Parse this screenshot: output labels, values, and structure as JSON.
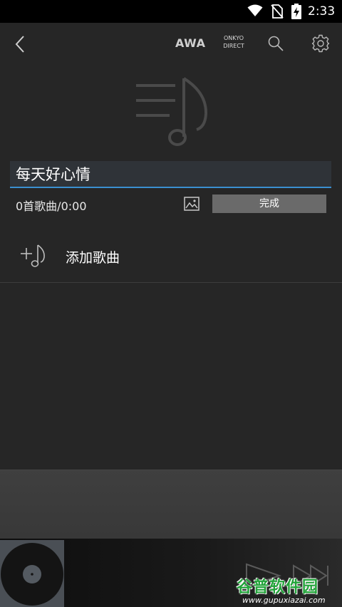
{
  "status_bar": {
    "time": "2:33",
    "icons": [
      "wifi-icon",
      "no-sim-icon",
      "battery-charging-icon"
    ]
  },
  "toolbar": {
    "back_icon": "chevron-left-icon",
    "awa_label": "AWA",
    "onkyo_line1": "ONKYO",
    "onkyo_line2": "DIRECT",
    "search_icon": "search-icon",
    "settings_icon": "gear-icon"
  },
  "playlist": {
    "title_value": "每天好心情",
    "song_count": "0首歌曲/0:00",
    "image_icon": "image-icon",
    "done_label": "完成"
  },
  "add_song": {
    "icon": "add-music-icon",
    "label": "添加歌曲"
  },
  "player": {
    "album_icon": "vinyl-record-icon",
    "controls": [
      "play-icon",
      "skip-next-icon"
    ]
  },
  "watermark": {
    "logo_text": "谷普软件园",
    "url": "www.gupuxiazai.com"
  },
  "colors": {
    "background": "#262626",
    "input_underline": "#3a8fd0",
    "done_button": "#6a6a6a",
    "watermark_green": "#22a33a"
  }
}
